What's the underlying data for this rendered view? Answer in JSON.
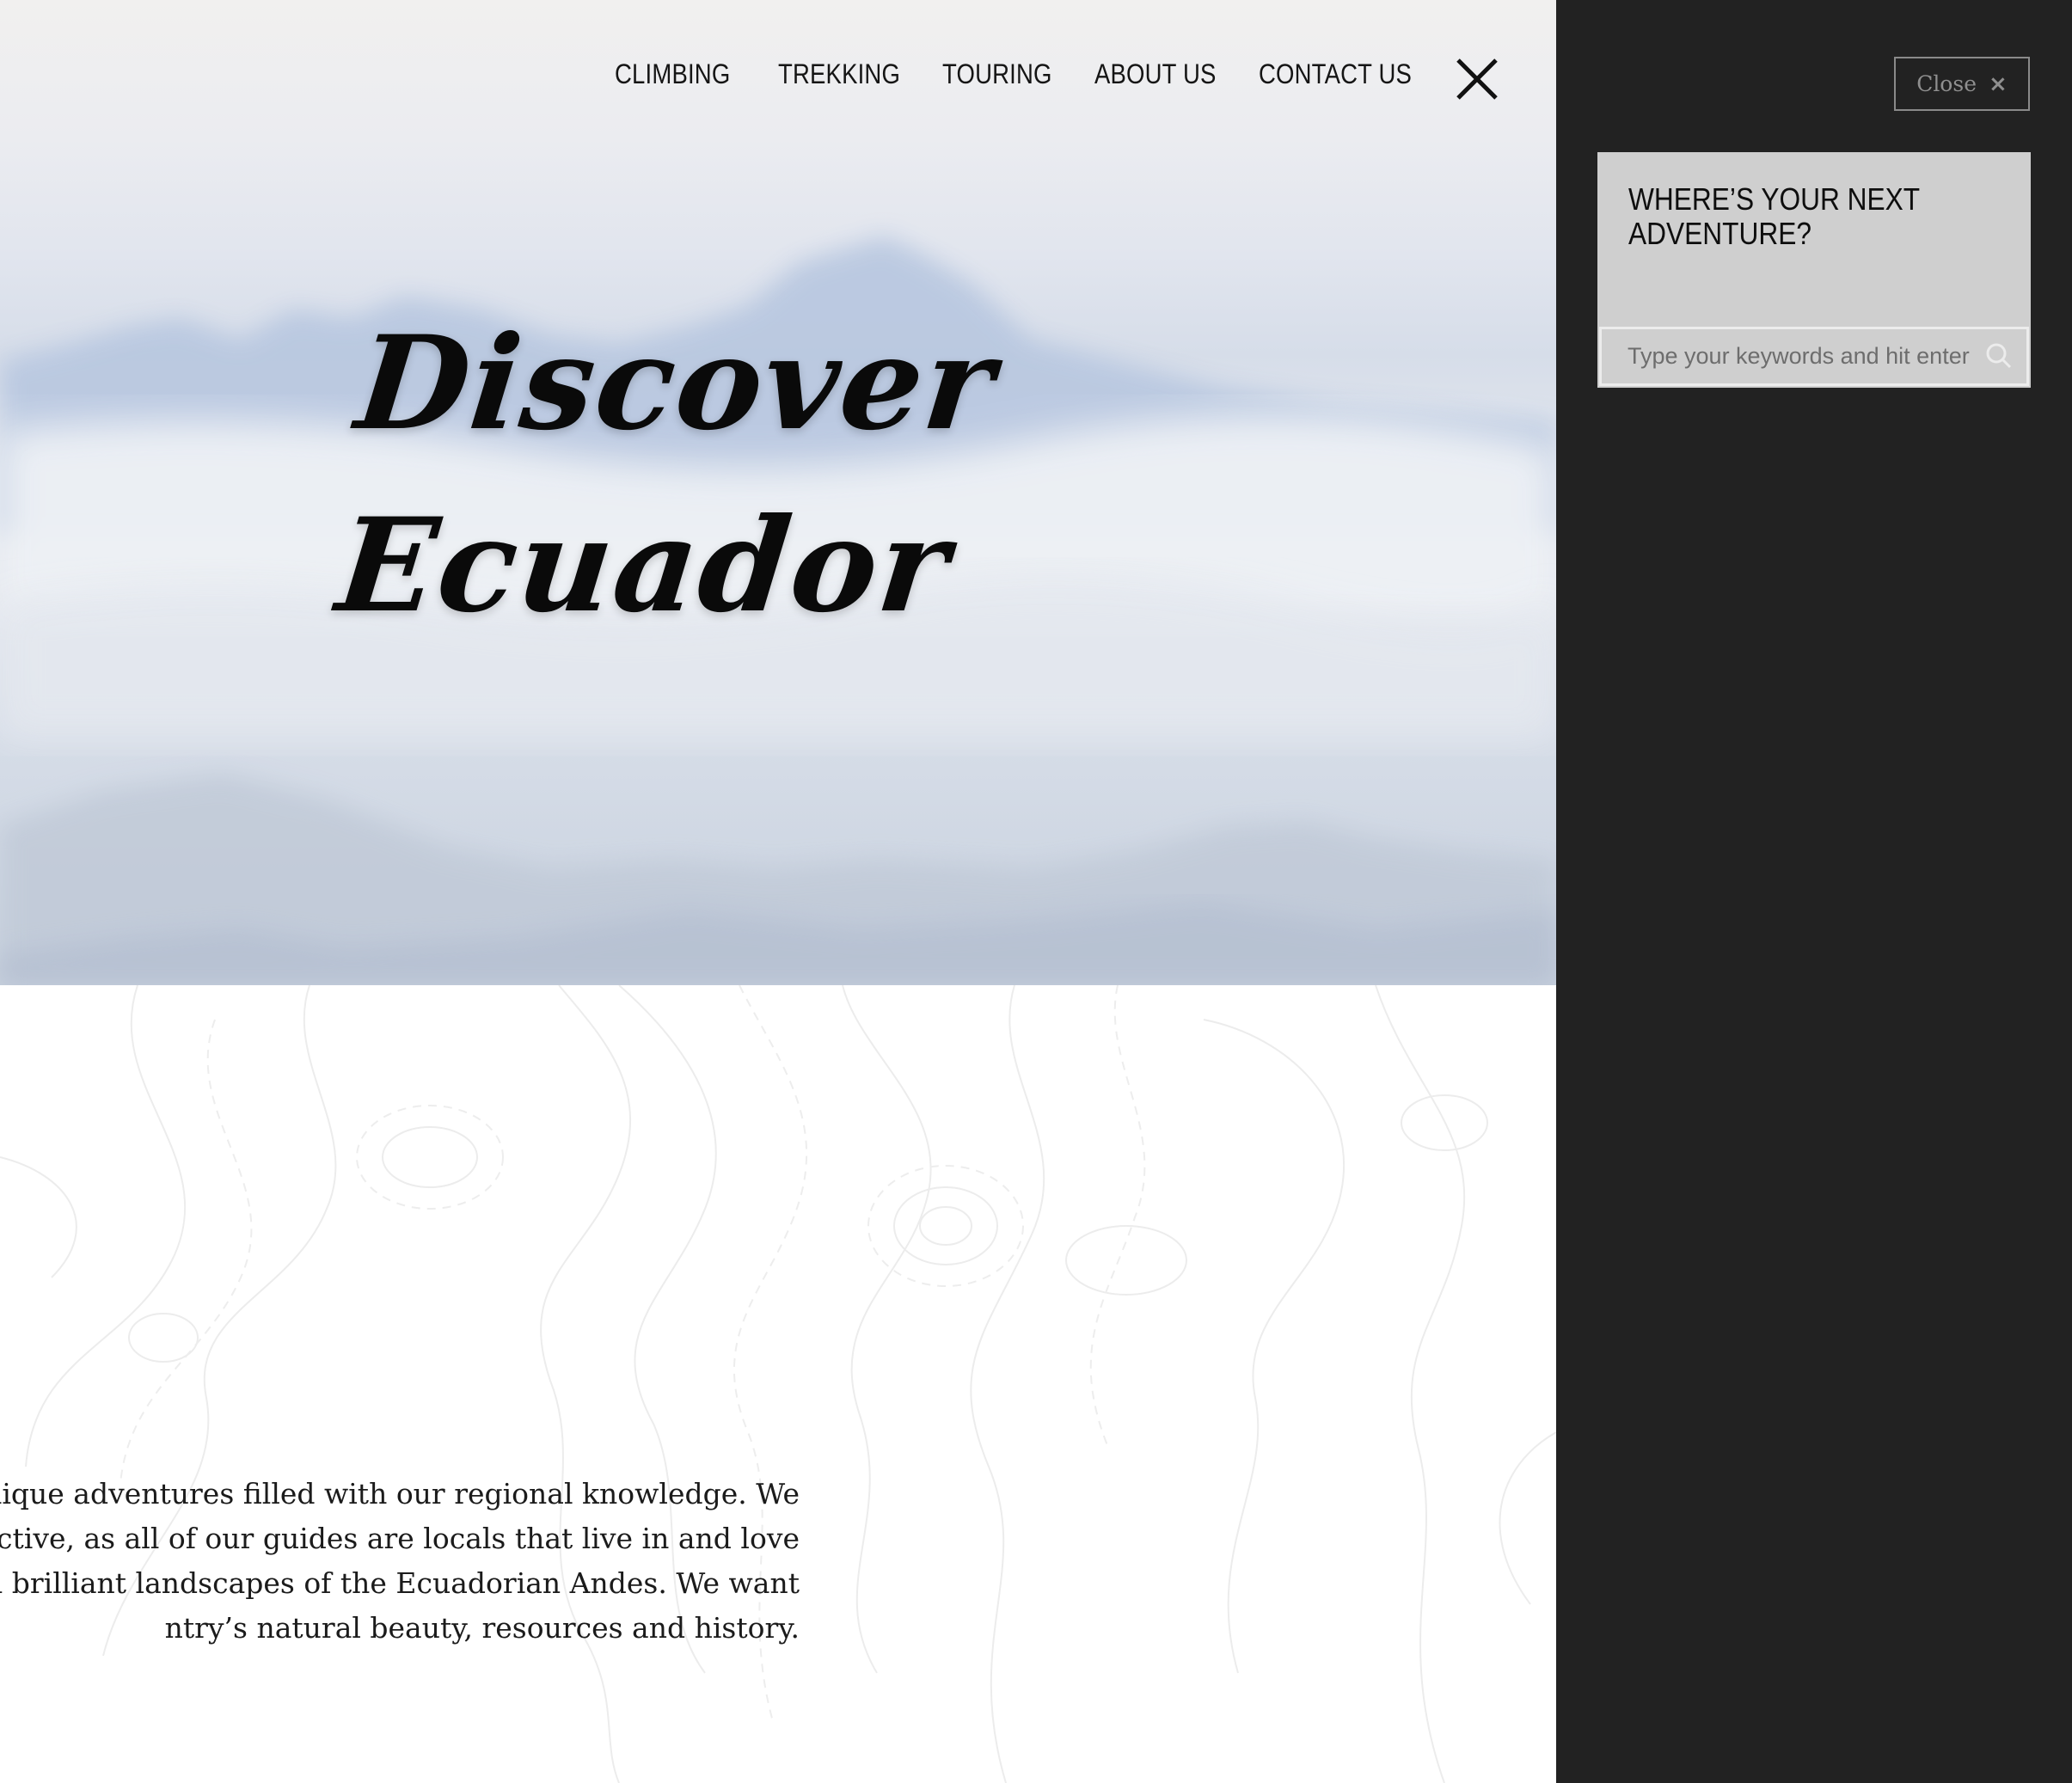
{
  "nav": {
    "items": [
      "CLIMBING",
      "TREKKING",
      "TOURING",
      "ABOUT US",
      "CONTACT US"
    ],
    "close_icon": "close-x-icon"
  },
  "hero": {
    "title_line1": "Discover",
    "title_line2": "Ecuador"
  },
  "intro": {
    "lines": [
      "u unique adventures filled with our regional knowledge. We",
      "rspective, as all of our guides are locals that live in and love",
      "and brilliant landscapes of the Ecuadorian Andes. We want",
      "ntry’s natural beauty, resources and history."
    ]
  },
  "panel": {
    "close_label": "Close",
    "close_icon": "×",
    "widget_title": "WHERE’S YOUR NEXT ADVENTURE?",
    "search_placeholder": "Type your keywords and hit enter",
    "search_icon": "search-icon"
  },
  "colors": {
    "panel_bg": "#222222",
    "widget_bg": "#cfcfcf",
    "text_dark": "#151515"
  }
}
